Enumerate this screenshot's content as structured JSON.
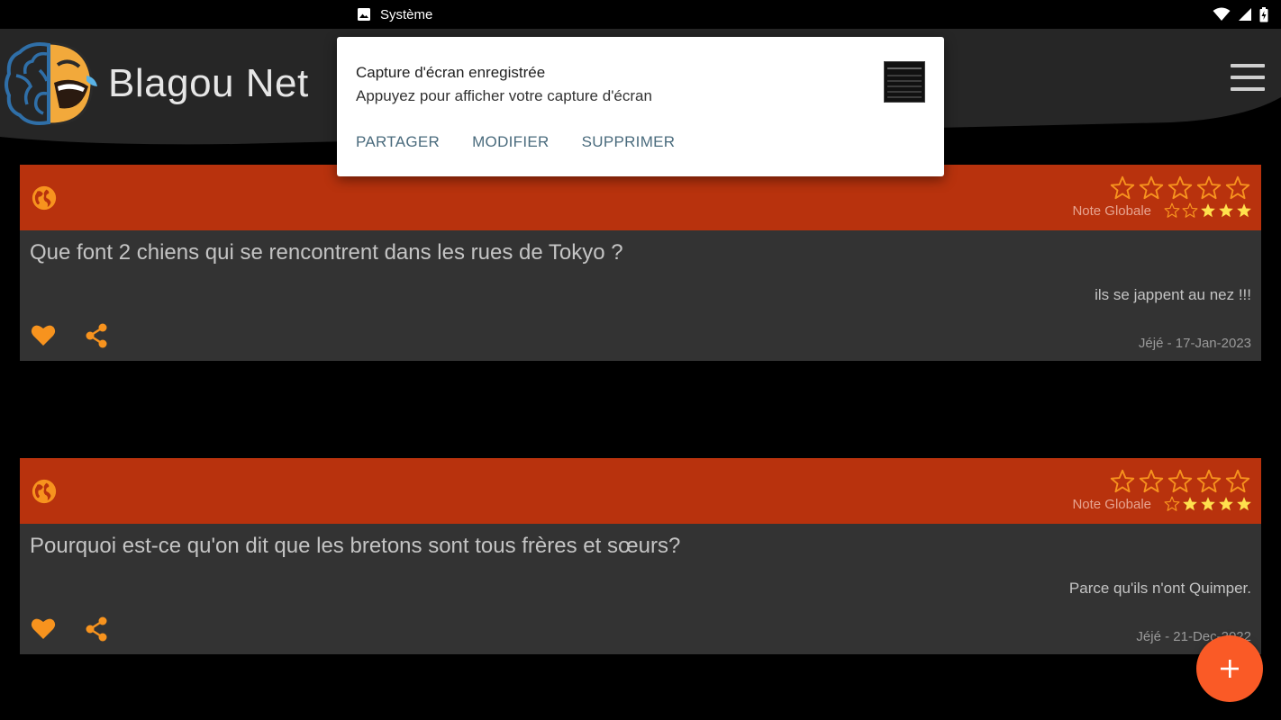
{
  "status_bar": {
    "notification_source": "Système",
    "icons": [
      "image-icon",
      "wifi-icon",
      "signal-icon",
      "battery-icon"
    ]
  },
  "app": {
    "title": "Blagou Net",
    "menu_icon": "hamburger-menu-icon"
  },
  "colors": {
    "card_header": "#b8320d",
    "card_body": "#333333",
    "accent_orange": "#f7931e",
    "star_filled": "#ffe14d",
    "fab": "#fa5a26",
    "notification_action": "#4a6b7d"
  },
  "jokes": [
    {
      "question": "Que font 2 chiens qui se rencontrent dans les rues de Tokyo  ?",
      "answer": "ils se jappent au nez !!!",
      "author_date": "Jéjé - 17-Jan-2023",
      "global_rating_label": "Note Globale",
      "user_rating_stars": 0,
      "global_rating_stars": 3,
      "star_count": 5
    },
    {
      "question": "Pourquoi est-ce qu'on dit que les bretons sont tous frères et sœurs?",
      "answer": "Parce qu'ils n'ont Quimper.",
      "author_date": "Jéjé - 21-Dec-2022",
      "global_rating_label": "Note Globale",
      "user_rating_stars": 0,
      "global_rating_stars": 4,
      "star_count": 5
    }
  ],
  "notification": {
    "title": "Capture d'écran enregistrée",
    "text": "Appuyez pour afficher votre capture d'écran",
    "actions": [
      "PARTAGER",
      "MODIFIER",
      "SUPPRIMER"
    ]
  },
  "fab": {
    "icon": "plus-icon"
  }
}
